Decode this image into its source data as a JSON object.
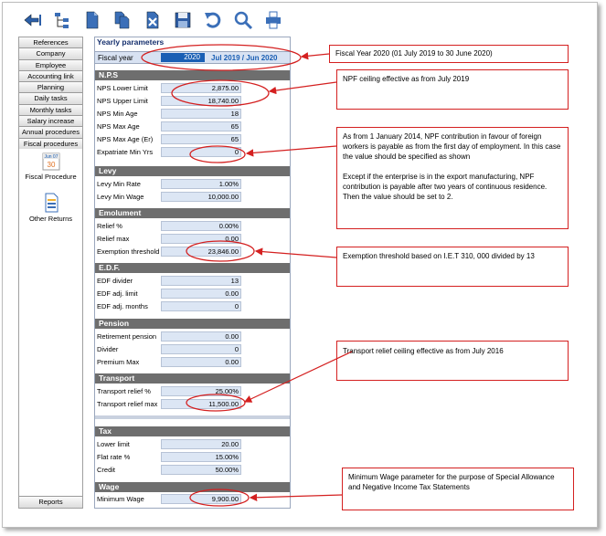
{
  "nav": {
    "items": [
      "References",
      "Company",
      "Employee",
      "Accounting link",
      "Planning",
      "Daily tasks",
      "Monthly tasks",
      "Salary increase",
      "Annual procedures",
      "Fiscal procedures"
    ],
    "tools": {
      "fiscal_procedure": "Fiscal Procedure",
      "other_returns": "Other Returns",
      "calendar_month": "Jun 07",
      "calendar_day": "30"
    },
    "reports": "Reports"
  },
  "panel": {
    "title": "Yearly parameters",
    "fiscal_year": {
      "label": "Fiscal year",
      "value": "2020",
      "range": "Jul 2019 / Jun 2020"
    },
    "sections": {
      "nps": {
        "title": "N.P.S",
        "rows": [
          {
            "label": "NPS Lower Limit",
            "value": "2,875.00"
          },
          {
            "label": "NPS Upper Limit",
            "value": "18,740.00"
          },
          {
            "label": "NPS Min Age",
            "value": "18"
          },
          {
            "label": "NPS Max Age",
            "value": "65"
          },
          {
            "label": "NPS Max Age (Er)",
            "value": "65"
          },
          {
            "label": "Expatriate Min Yrs",
            "value": "0"
          }
        ]
      },
      "levy": {
        "title": "Levy",
        "rows": [
          {
            "label": "Levy Min Rate",
            "value": "1.00%"
          },
          {
            "label": "Levy Min Wage",
            "value": "10,000.00"
          }
        ]
      },
      "emolument": {
        "title": "Emolument",
        "rows": [
          {
            "label": "Relief %",
            "value": "0.00%"
          },
          {
            "label": "Relief max",
            "value": "0.00"
          },
          {
            "label": "Exemption threshold",
            "value": "23,846.00"
          }
        ]
      },
      "edf": {
        "title": "E.D.F.",
        "rows": [
          {
            "label": "EDF divider",
            "value": "13"
          },
          {
            "label": "EDF adj. limit",
            "value": "0.00"
          },
          {
            "label": "EDF adj. months",
            "value": "0"
          }
        ]
      },
      "pension": {
        "title": "Pension",
        "rows": [
          {
            "label": "Retirement pension",
            "value": "0.00"
          },
          {
            "label": "Divider",
            "value": "0"
          },
          {
            "label": "Premium Max",
            "value": "0.00"
          }
        ]
      },
      "transport": {
        "title": "Transport",
        "rows": [
          {
            "label": "Transport relief %",
            "value": "25.00%"
          },
          {
            "label": "Transport relief max",
            "value": "11,500.00"
          }
        ]
      },
      "tax": {
        "title": "Tax",
        "rows": [
          {
            "label": "Lower limit",
            "value": "20.00"
          },
          {
            "label": "Flat rate %",
            "value": "15.00%"
          },
          {
            "label": "Credit",
            "value": "50.00%"
          }
        ]
      },
      "wage": {
        "title": "Wage",
        "rows": [
          {
            "label": "Minimum Wage",
            "value": "9,900.00"
          }
        ]
      }
    }
  },
  "notes": {
    "fiscal_year": "Fiscal Year 2020 (01 July 2019 to 30 June 2020)",
    "npf_ceiling": "NPF ceiling effective as from July 2019",
    "foreign_p1": "As from 1 January 2014, NPF contribution in favour of foreign workers is payable as from the first day of employment. In this case the value should be specified as shown",
    "foreign_p2": "Except if the enterprise is in the export manufacturing, NPF contribution is payable after two years of continuous residence. Then the value should be set to 2.",
    "exemption": "Exemption threshold based on I.E.T 310, 000 divided by 13",
    "transport": "Transport relief ceiling effective as from July 2016",
    "minimum_wage": "Minimum Wage parameter for the purpose of Special Allowance and Negative Income Tax Statements"
  },
  "colors": {
    "accent": "#1a5fb4",
    "annotation": "#d42020",
    "section": "#6e6e6e"
  },
  "icons": [
    "back-arrow-icon",
    "tree-icon",
    "document-icon",
    "copy-documents-icon",
    "delete-document-icon",
    "save-icon",
    "undo-icon",
    "search-icon",
    "print-icon"
  ]
}
